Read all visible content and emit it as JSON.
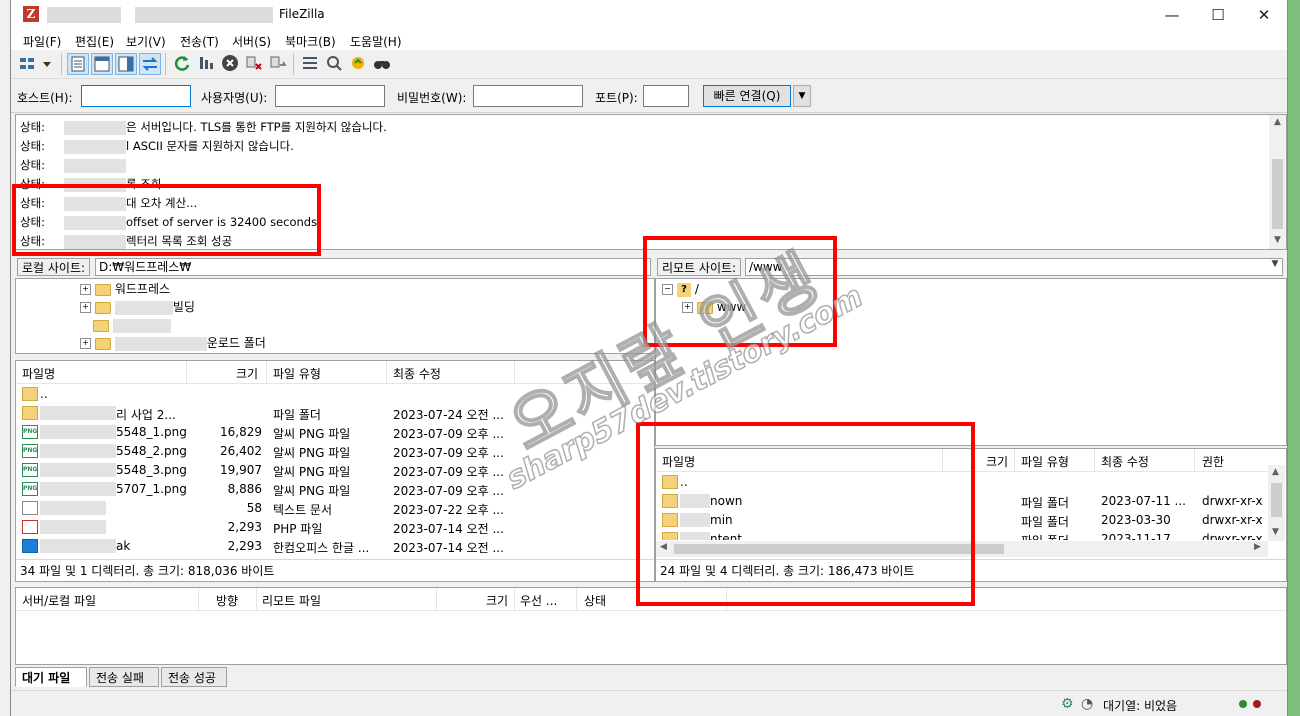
{
  "window": {
    "title": "FileZilla",
    "app_icon_glyph": "Z",
    "min_glyph": "—",
    "max_glyph": "☐",
    "close_glyph": "✕"
  },
  "menu": [
    "파일(F)",
    "편집(E)",
    "보기(V)",
    "전송(T)",
    "서버(S)",
    "북마크(B)",
    "도움말(H)"
  ],
  "quickconnect": {
    "host_label": "호스트(H):",
    "host_value": "",
    "user_label": "사용자명(U):",
    "user_value": "",
    "pass_label": "비밀번호(W):",
    "pass_value": "",
    "port_label": "포트(P):",
    "port_value": "",
    "connect_label": "빠른 연결(Q)",
    "dropdown_glyph": "▼"
  },
  "log": {
    "lines": [
      {
        "label": "상태:",
        "text": "은 서버입니다. TLS를 통한 FTP를 지원하지 않습니다."
      },
      {
        "label": "상태:",
        "text": "l ASCII 문자를 지원하지 않습니다."
      },
      {
        "label": "상태:",
        "text": ""
      },
      {
        "label": "상태:",
        "text": "록 조회"
      },
      {
        "label": "상태:",
        "text": "대 오차 계산..."
      },
      {
        "label": "상태:",
        "text": "offset of server is 32400 seconds."
      },
      {
        "label": "상태:",
        "text": "렉터리 목록 조회 성공"
      }
    ]
  },
  "local": {
    "path_label": "로컬 사이트:",
    "path_value": "D:₩워드프레스₩",
    "tree": [
      {
        "label": "워드프레스"
      },
      {
        "label": "빌딩"
      },
      {
        "label": ""
      },
      {
        "label": "운로드 폴더"
      }
    ],
    "columns": {
      "name": "파일명",
      "size": "크기",
      "type": "파일 유형",
      "modified": "최종 수정"
    },
    "files": [
      {
        "name": "..",
        "size": "",
        "type": "",
        "modified": "",
        "icon": "folder"
      },
      {
        "name": "리 사업 2...",
        "size": "",
        "type": "파일 폴더",
        "modified": "2023-07-24 오전 ...",
        "icon": "folder"
      },
      {
        "name": "5548_1.png",
        "size": "16,829",
        "type": "알씨 PNG 파일",
        "modified": "2023-07-09 오후 ...",
        "icon": "png"
      },
      {
        "name": "5548_2.png",
        "size": "26,402",
        "type": "알씨 PNG 파일",
        "modified": "2023-07-09 오후 ...",
        "icon": "png"
      },
      {
        "name": "5548_3.png",
        "size": "19,907",
        "type": "알씨 PNG 파일",
        "modified": "2023-07-09 오후 ...",
        "icon": "png"
      },
      {
        "name": "5707_1.png",
        "size": "8,886",
        "type": "알씨 PNG 파일",
        "modified": "2023-07-09 오후 ...",
        "icon": "png"
      },
      {
        "name": "",
        "size": "58",
        "type": "텍스트 문서",
        "modified": "2023-07-22 오후 ...",
        "icon": "txt"
      },
      {
        "name": "",
        "size": "2,293",
        "type": "PHP 파일",
        "modified": "2023-07-14 오전 ...",
        "icon": "php"
      },
      {
        "name": "ak",
        "size": "2,293",
        "type": "한컴오피스 한글 ...",
        "modified": "2023-07-14 오전 ...",
        "icon": "hwp"
      }
    ],
    "summary": "34 파일 및 1 디렉터리. 총 크기: 818,036 바이트"
  },
  "remote": {
    "path_label": "리모트 사이트:",
    "path_value": "/www",
    "tree": [
      {
        "label": "/"
      },
      {
        "label": "www"
      }
    ],
    "columns": {
      "name": "파일명",
      "size": "크기",
      "type": "파일 유형",
      "modified": "최종 수정",
      "perm": "권한"
    },
    "files": [
      {
        "name": "..",
        "type": "",
        "modified": "",
        "perm": ""
      },
      {
        "name": "nown",
        "type": "파일 폴더",
        "modified": "2023-07-11 ...",
        "perm": "drwxr-xr-x"
      },
      {
        "name": "min",
        "type": "파일 폴더",
        "modified": "2023-03-30",
        "perm": "drwxr-xr-x"
      },
      {
        "name": "ntent",
        "type": "파일 폴더",
        "modified": "2023-11-17",
        "perm": "drwxr-xr-x"
      }
    ],
    "summary": "24 파일 및 4 디렉터리. 총 크기: 186,473 바이트"
  },
  "queue": {
    "columns": {
      "server_local": "서버/로컬 파일",
      "direction": "방향",
      "remote": "리모트 파일",
      "size": "크기",
      "priority": "우선 ...",
      "status": "상태"
    },
    "tabs": [
      "대기 파일",
      "전송 실패",
      "전송 성공"
    ]
  },
  "statusbar": {
    "queue_text": "대기열: 비었음"
  },
  "watermark": {
    "main": "오지랖 인생",
    "sub": "sharp57dev.tistory.com"
  },
  "colors": {
    "highlight": "#ff0000",
    "accent": "#0078d7"
  }
}
